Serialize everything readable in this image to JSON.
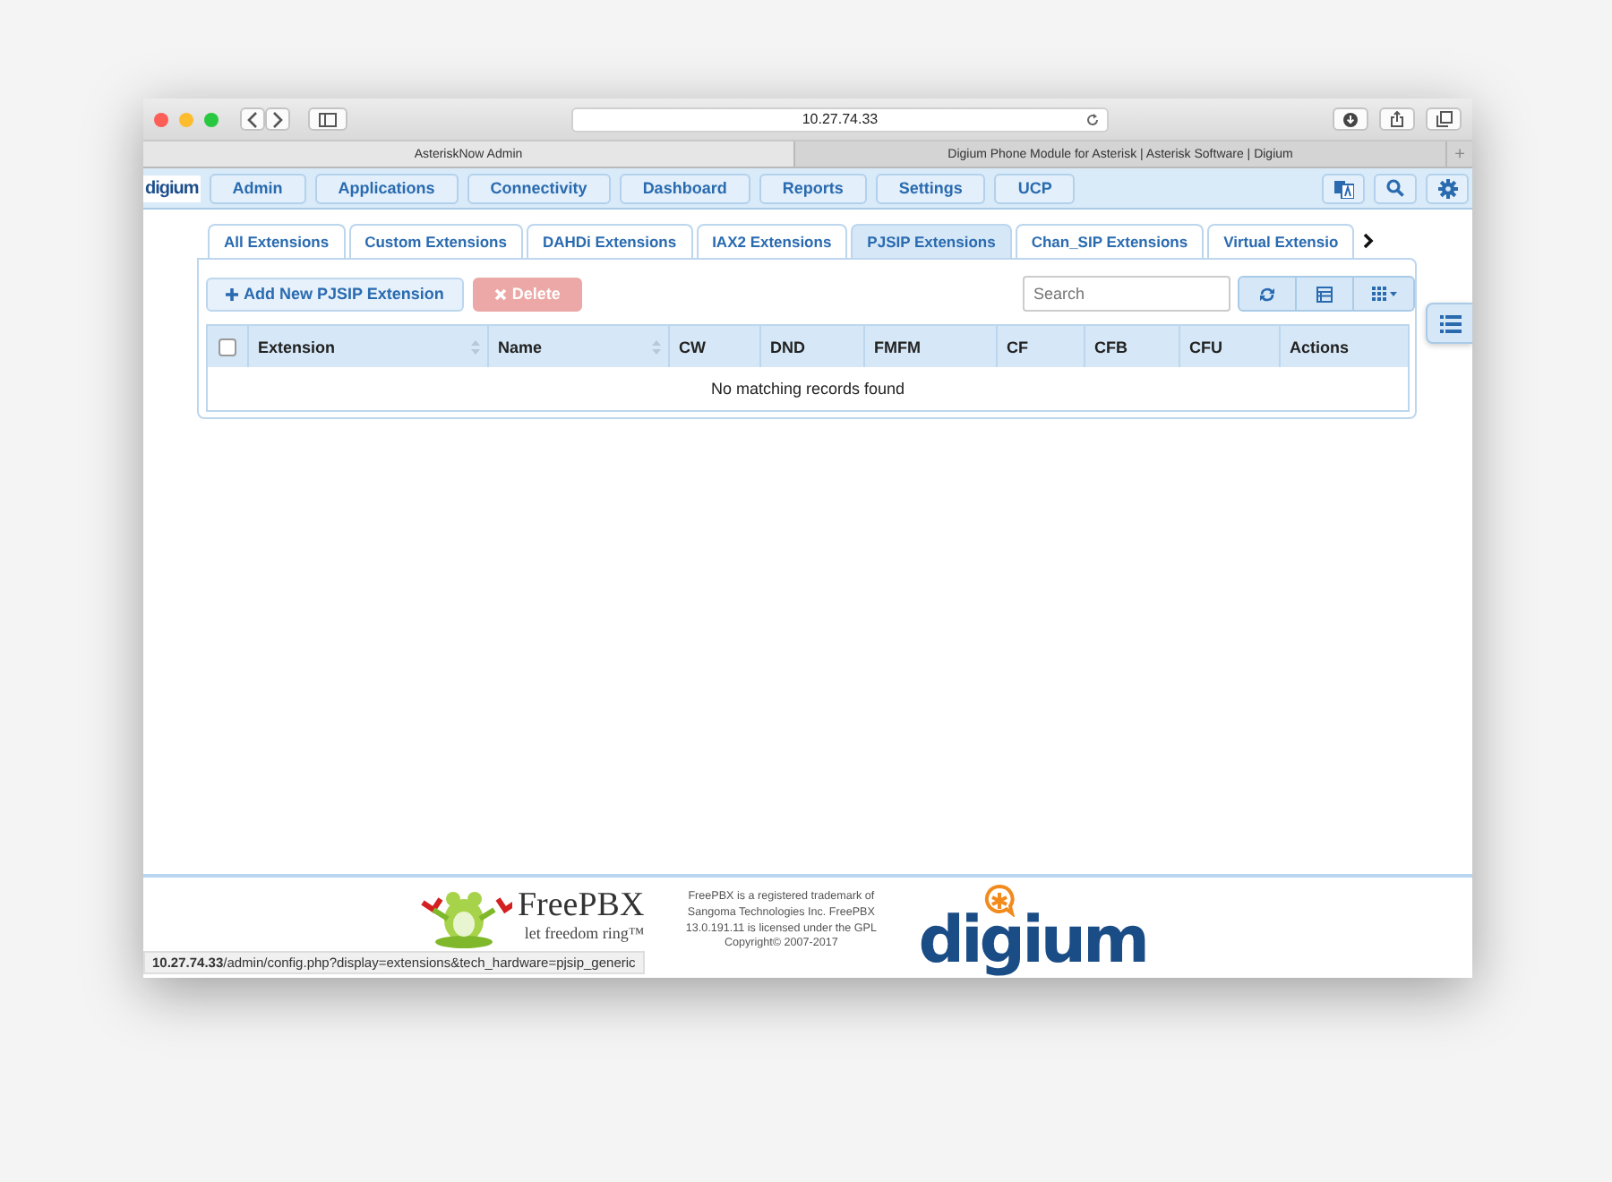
{
  "browser": {
    "url": "10.27.74.33",
    "tabs": [
      {
        "title": "AsteriskNow Admin",
        "selected": true
      },
      {
        "title": "Digium Phone Module for Asterisk | Asterisk Software | Digium",
        "selected": false
      }
    ],
    "new_tab": "+"
  },
  "nav": {
    "logo": "digium",
    "items": [
      "Admin",
      "Applications",
      "Connectivity",
      "Dashboard",
      "Reports",
      "Settings",
      "UCP"
    ]
  },
  "tabs": [
    {
      "label": "All Extensions",
      "selected": false
    },
    {
      "label": "Custom Extensions",
      "selected": false
    },
    {
      "label": "DAHDi Extensions",
      "selected": false
    },
    {
      "label": "IAX2 Extensions",
      "selected": false
    },
    {
      "label": "PJSIP Extensions",
      "selected": true
    },
    {
      "label": "Chan_SIP Extensions",
      "selected": false
    },
    {
      "label": "Virtual Extensio",
      "selected": false
    }
  ],
  "toolbar": {
    "add_button": "Add New PJSIP Extension",
    "delete_button": {
      "label": "Delete",
      "disabled": true
    },
    "search": {
      "placeholder": "Search"
    }
  },
  "table": {
    "select_all": {
      "checked": false
    },
    "columns": [
      {
        "label": "Extension",
        "sortable": true
      },
      {
        "label": "Name",
        "sortable": true
      },
      {
        "label": "CW",
        "sortable": false
      },
      {
        "label": "DND",
        "sortable": false
      },
      {
        "label": "FMFM",
        "sortable": false
      },
      {
        "label": "CF",
        "sortable": false
      },
      {
        "label": "CFB",
        "sortable": false
      },
      {
        "label": "CFU",
        "sortable": false
      },
      {
        "label": "Actions",
        "sortable": false
      }
    ],
    "empty_message": "No matching records found"
  },
  "footer": {
    "freepbx_name": "FreePBX",
    "freepbx_tagline": "let freedom ring™",
    "legal": "FreePBX is a registered trademark of Sangoma Technologies Inc. FreePBX 13.0.191.11 is licensed under the GPL",
    "copyright": "Copyright© 2007-2017",
    "digium_logo": "digium"
  },
  "status_bar": "**10.27.74.33**/admin/config.php?display=extensions&tech_hardware=pjsip_generic"
}
